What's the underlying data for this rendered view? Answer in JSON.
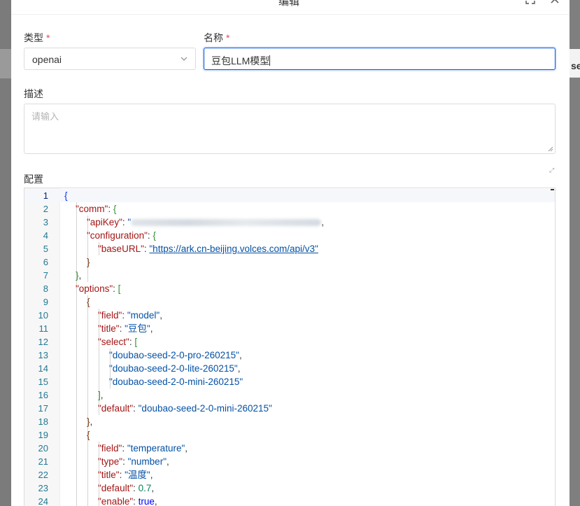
{
  "modal": {
    "title": "编辑",
    "fullscreen_icon": "fullscreen-icon",
    "close_icon": "close-icon"
  },
  "form": {
    "type": {
      "label": "类型",
      "required_mark": "*",
      "value": "openai"
    },
    "name": {
      "label": "名称",
      "required_mark": "*",
      "value": "豆包LLM模型"
    },
    "description": {
      "label": "描述",
      "placeholder": "请输入"
    },
    "config": {
      "label": "配置"
    }
  },
  "background": {
    "partial_text": "se"
  },
  "editor": {
    "line_numbers": [
      "1",
      "2",
      "3",
      "4",
      "5",
      "6",
      "7",
      "8",
      "9",
      "10",
      "11",
      "12",
      "13",
      "14",
      "15",
      "16",
      "17",
      "18",
      "19",
      "20",
      "21",
      "22",
      "23",
      "24"
    ],
    "lines": [
      {
        "open": "{"
      },
      {
        "key": "\"comm\"",
        "sep": ": ",
        "open": "{"
      },
      {
        "key": "\"apiKey\"",
        "sep": ": ",
        "str": "\"",
        "redacted": true,
        "tail": ","
      },
      {
        "key": "\"configuration\"",
        "sep": ": ",
        "open": "{"
      },
      {
        "key": "\"baseURL\"",
        "sep": ": ",
        "str": "\"https://ark.cn-beijing.volces.com/api/v3\"",
        "link": true
      },
      {
        "close": "}"
      },
      {
        "close": "}",
        "tail": ","
      },
      {
        "key": "\"options\"",
        "sep": ": ",
        "open": "["
      },
      {
        "open": "{"
      },
      {
        "key": "\"field\"",
        "sep": ": ",
        "str": "\"model\"",
        "tail": ","
      },
      {
        "key": "\"title\"",
        "sep": ": ",
        "str": "\"豆包\"",
        "tail": ","
      },
      {
        "key": "\"select\"",
        "sep": ": ",
        "open": "["
      },
      {
        "str": "\"doubao-seed-2-0-pro-260215\"",
        "tail": ","
      },
      {
        "str": "\"doubao-seed-2-0-lite-260215\"",
        "tail": ","
      },
      {
        "str": "\"doubao-seed-2-0-mini-260215\""
      },
      {
        "close": "]",
        "tail": ","
      },
      {
        "key": "\"default\"",
        "sep": ": ",
        "str": "\"doubao-seed-2-0-mini-260215\""
      },
      {
        "close": "}",
        "tail": ","
      },
      {
        "open": "{"
      },
      {
        "key": "\"field\"",
        "sep": ": ",
        "str": "\"temperature\"",
        "tail": ","
      },
      {
        "key": "\"type\"",
        "sep": ": ",
        "str": "\"number\"",
        "tail": ","
      },
      {
        "key": "\"title\"",
        "sep": ": ",
        "str": "\"温度\"",
        "tail": ","
      },
      {
        "key": "\"default\"",
        "sep": ": ",
        "num": "0.7",
        "tail": ","
      },
      {
        "key": "\"enable\"",
        "sep": ": ",
        "kw": "true",
        "tail": ","
      }
    ]
  }
}
